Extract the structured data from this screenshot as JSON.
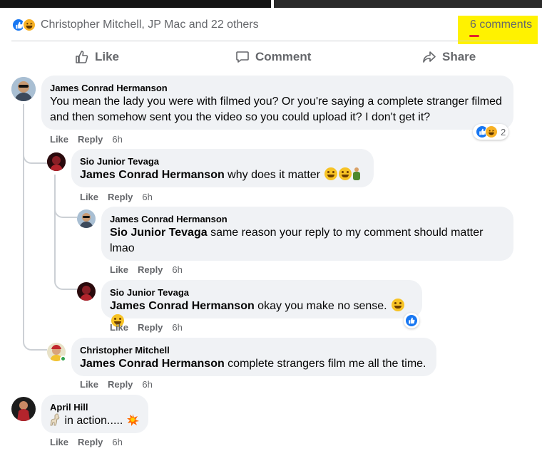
{
  "post_footer": {
    "reactors_text": "Christopher Mitchell, JP Mac and 22 others",
    "comments_count": "6 comments",
    "highlight_color": "#fff200"
  },
  "actions": {
    "like": "Like",
    "comment": "Comment",
    "share": "Share"
  },
  "comments": [
    {
      "author": "James Conrad Hermanson",
      "text": "You mean the lady you were with filmed you? Or you're saying a complete stranger filmed and then somehow sent you the video so you could upload it? I don't get it?",
      "like": "Like",
      "reply": "Reply",
      "time": "6h",
      "reaction_count": "2"
    },
    {
      "author": "Sio Junior Tevaga",
      "mention": "James Conrad Hermanson",
      "text": " why does it matter",
      "like": "Like",
      "reply": "Reply",
      "time": "6h"
    },
    {
      "author": "James Conrad Hermanson",
      "mention": "Sio Junior Tevaga",
      "text": " same reason your reply to my comment should matter lmao",
      "like": "Like",
      "reply": "Reply",
      "time": "6h"
    },
    {
      "author": "Sio Junior Tevaga",
      "mention": "James Conrad Hermanson",
      "text": " okay you make no sense.",
      "like": "Like",
      "reply": "Reply",
      "time": "6h"
    },
    {
      "author": "Christopher Mitchell",
      "mention": "James Conrad Hermanson",
      "text": " complete strangers film me all the time.",
      "like": "Like",
      "reply": "Reply",
      "time": "6h"
    },
    {
      "author": "April Hill",
      "text": "in action.....",
      "like": "Like",
      "reply": "Reply",
      "time": "6h"
    }
  ],
  "colors": {
    "facebook_blue": "#1877f2",
    "bubble_bg": "#f0f2f5",
    "muted_text": "#65676b"
  }
}
